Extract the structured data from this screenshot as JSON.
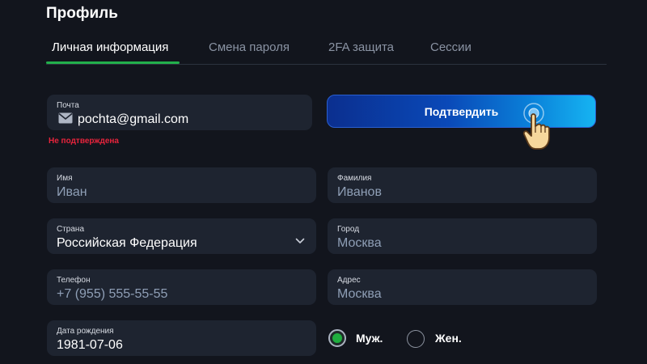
{
  "page": {
    "title": "Профиль"
  },
  "tabs": [
    {
      "label": "Личная информация",
      "active": true
    },
    {
      "label": "Смена пароля",
      "active": false
    },
    {
      "label": "2FA защита",
      "active": false
    },
    {
      "label": "Сессии",
      "active": false
    }
  ],
  "email": {
    "label": "Почта",
    "value": "pochta@gmail.com",
    "icon": "mail-icon",
    "status": "Не подтверждена",
    "status_color": "#e8243c"
  },
  "confirm_button": {
    "label": "Подтвердить"
  },
  "fields": {
    "first_name": {
      "label": "Имя",
      "value": "Иван"
    },
    "last_name": {
      "label": "Фамилия",
      "value": "Иванов"
    },
    "country": {
      "label": "Страна",
      "value": "Российская Федерация"
    },
    "city": {
      "label": "Город",
      "value": "Москва"
    },
    "phone": {
      "label": "Телефон",
      "value": "+7 (955) 555-55-55"
    },
    "address": {
      "label": "Адрес",
      "value": "Москва"
    },
    "birthdate": {
      "label": "Дата рождения",
      "value": "1981-07-06"
    }
  },
  "gender": {
    "options": [
      {
        "label": "Муж.",
        "checked": true
      },
      {
        "label": "Жен.",
        "checked": false
      }
    ]
  },
  "colors": {
    "background": "#12151d",
    "field_bg": "#1e2430",
    "accent_green": "#22b04b",
    "button_gradient_start": "#0b2f8f",
    "button_gradient_end": "#16b4f2"
  }
}
